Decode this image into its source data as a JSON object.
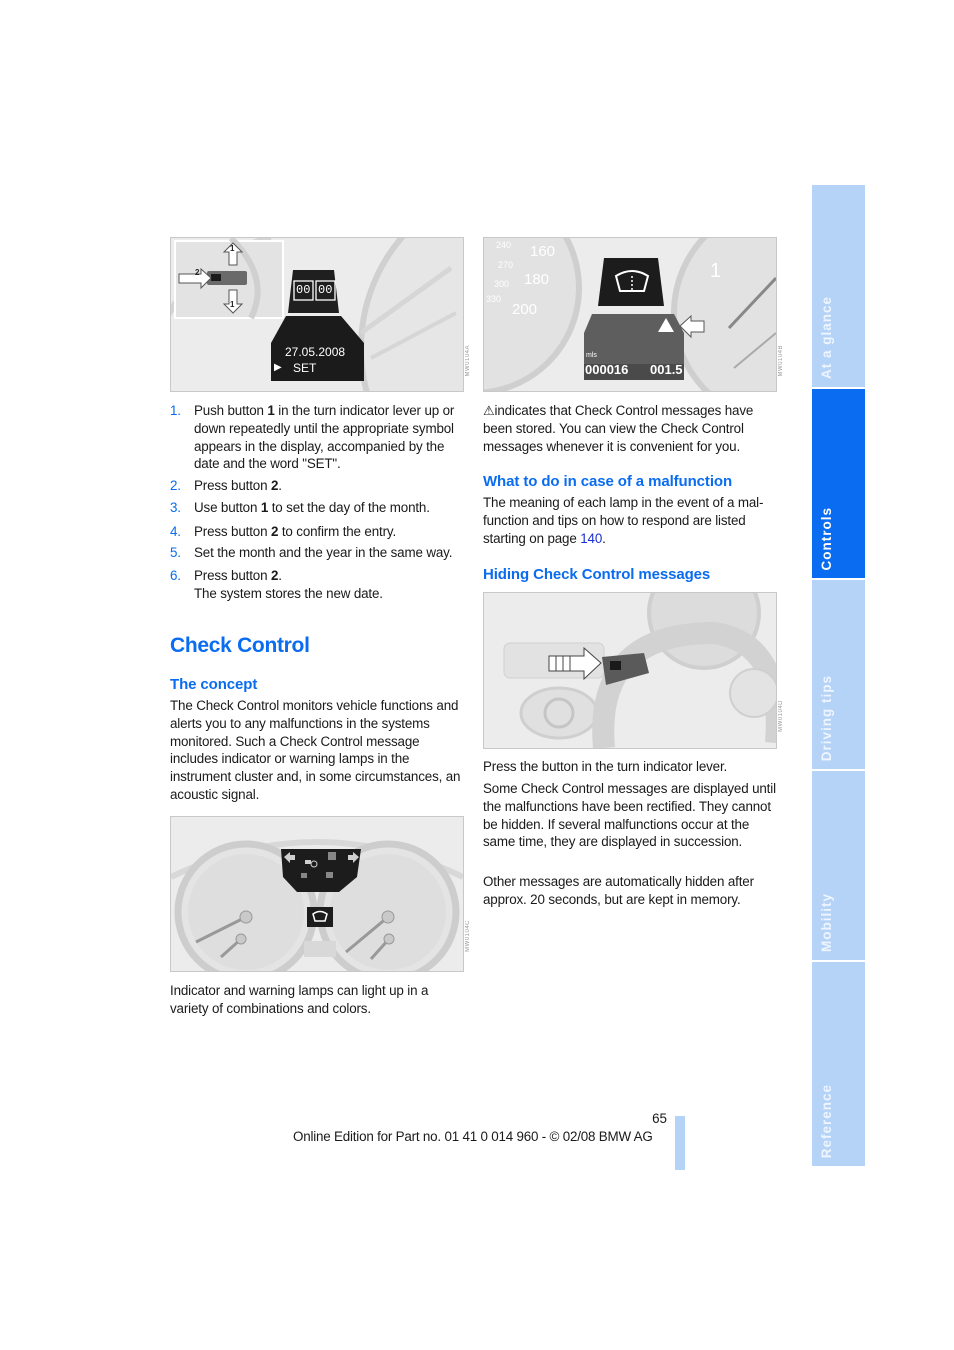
{
  "side_nav": {
    "tabs": [
      {
        "label": "At a glance",
        "active": false
      },
      {
        "label": "Controls",
        "active": true
      },
      {
        "label": "Driving tips",
        "active": false
      },
      {
        "label": "Mobility",
        "active": false
      },
      {
        "label": "Reference",
        "active": false
      }
    ]
  },
  "figures": {
    "date_setting": {
      "display_date": "27.05.2008",
      "display_set": "SET",
      "button_labels": [
        "1",
        "2",
        "1"
      ],
      "calendar_digits": [
        "00",
        "00"
      ]
    },
    "check_control_display": {
      "odometer": "000016",
      "trip": "001.5",
      "unit": "mls",
      "speed_ticks": [
        "240",
        "270",
        "300",
        "330",
        "160",
        "180",
        "200"
      ],
      "rpm_tick": "1"
    },
    "instrument_cluster": {},
    "turn_indicator_lever": {}
  },
  "left_column": {
    "steps": [
      {
        "num": "1.",
        "parts": [
          {
            "t": "Push button "
          },
          {
            "t": "1",
            "b": true
          },
          {
            "t": " in the turn indicator lever up or down repeatedly until the appropriate symbol appears in the display, accompa­nied by the date and the word \"SET\"."
          }
        ]
      },
      {
        "num": "2.",
        "parts": [
          {
            "t": "Press button "
          },
          {
            "t": "2",
            "b": true
          },
          {
            "t": "."
          }
        ]
      },
      {
        "num": "3.",
        "parts": [
          {
            "t": "Use button "
          },
          {
            "t": "1",
            "b": true
          },
          {
            "t": " to set the day of the month."
          }
        ]
      },
      {
        "num": "4.",
        "parts": [
          {
            "t": "Press button "
          },
          {
            "t": "2",
            "b": true
          },
          {
            "t": " to confirm the entry."
          }
        ]
      },
      {
        "num": "5.",
        "parts": [
          {
            "t": "Set the month and the year in the same way."
          }
        ]
      },
      {
        "num": "6.",
        "parts": [
          {
            "t": "Press button "
          },
          {
            "t": "2",
            "b": true
          },
          {
            "t": "."
          }
        ],
        "sub": "The system stores the new date."
      }
    ],
    "section_title": "Check Control",
    "concept_heading": "The concept",
    "concept_text": "The Check Control monitors vehicle functions and alerts you to any malfunctions in the sys­tems monitored. Such a Check Control mes­sage includes indicator or warning lamps in the instrument cluster and, in some circumstances, an acoustic signal.",
    "cluster_caption": "Indicator and warning lamps can light up in a variety of combinations and colors."
  },
  "right_column": {
    "warning_text": "indicates that Check Control messages have been stored. You can view the Check Control messages whenever it is convenient for you.",
    "malfunction_heading": "What to do in case of a malfunction",
    "malfunction_text_before": "The meaning of each lamp in the event of a mal­function and tips on how to respond are listed starting on page ",
    "malfunction_page_link": "140",
    "malfunction_text_after": ".",
    "hiding_heading": "Hiding Check Control messages",
    "hiding_instruction": "Press the button in the turn indicator lever.",
    "hiding_para1": "Some Check Control messages are displayed until the malfunctions have been rectified. They cannot be hidden. If several malfunctions occur at the same time, they are displayed in succes­sion.",
    "hiding_para2": "Other messages are automatically hidden after approx. 20 seconds, but are kept in memory."
  },
  "footer": {
    "page_number": "65",
    "edition_text": "Online Edition for Part no. 01 41 0 014 960 - © 02/08 BMW AG"
  },
  "colors": {
    "accent": "#0a6cf0",
    "tab_inactive": "#b5d3f7",
    "link": "#1a2fd6"
  }
}
